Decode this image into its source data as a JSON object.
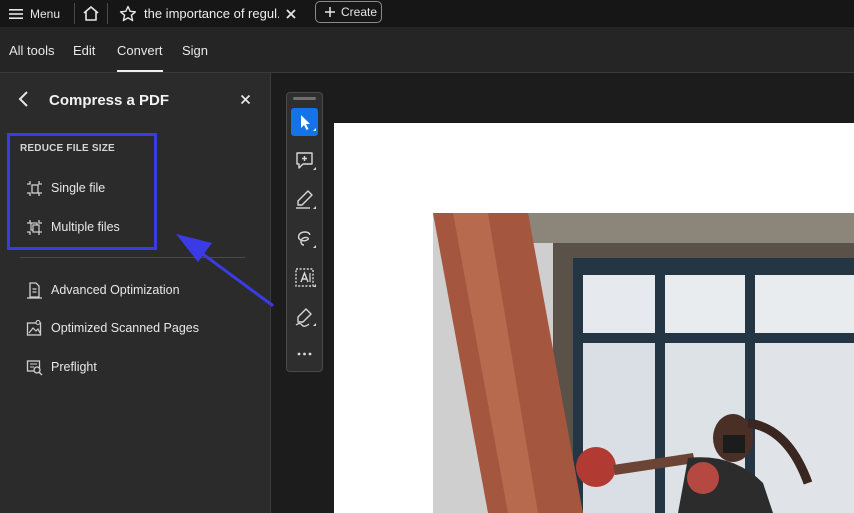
{
  "topbar": {
    "menu_label": "Menu",
    "tab_title": "the importance of regul...",
    "create_label": "Create"
  },
  "nav": {
    "tabs": [
      {
        "label": "All tools"
      },
      {
        "label": "Edit"
      },
      {
        "label": "Convert",
        "active": true
      },
      {
        "label": "Sign"
      }
    ]
  },
  "panel": {
    "title": "Compress a PDF",
    "section_label": "REDUCE FILE SIZE",
    "items": [
      {
        "label": "Single file",
        "icon": "single-file-compress-icon"
      },
      {
        "label": "Multiple files",
        "icon": "multiple-files-compress-icon"
      },
      {
        "label": "Advanced Optimization",
        "icon": "advanced-optimization-icon"
      },
      {
        "label": "Optimized Scanned Pages",
        "icon": "scanned-pages-icon"
      },
      {
        "label": "Preflight",
        "icon": "preflight-icon"
      }
    ]
  },
  "toolbar": {
    "tools": [
      "select-pointer-icon",
      "add-comment-icon",
      "highlight-pen-icon",
      "draw-freehand-icon",
      "text-recognition-icon",
      "sign-pen-icon",
      "more-tools-icon"
    ],
    "active_tool": "select-pointer-icon"
  },
  "colors": {
    "accent": "#1473e6",
    "annotation": "#3b3be6"
  }
}
